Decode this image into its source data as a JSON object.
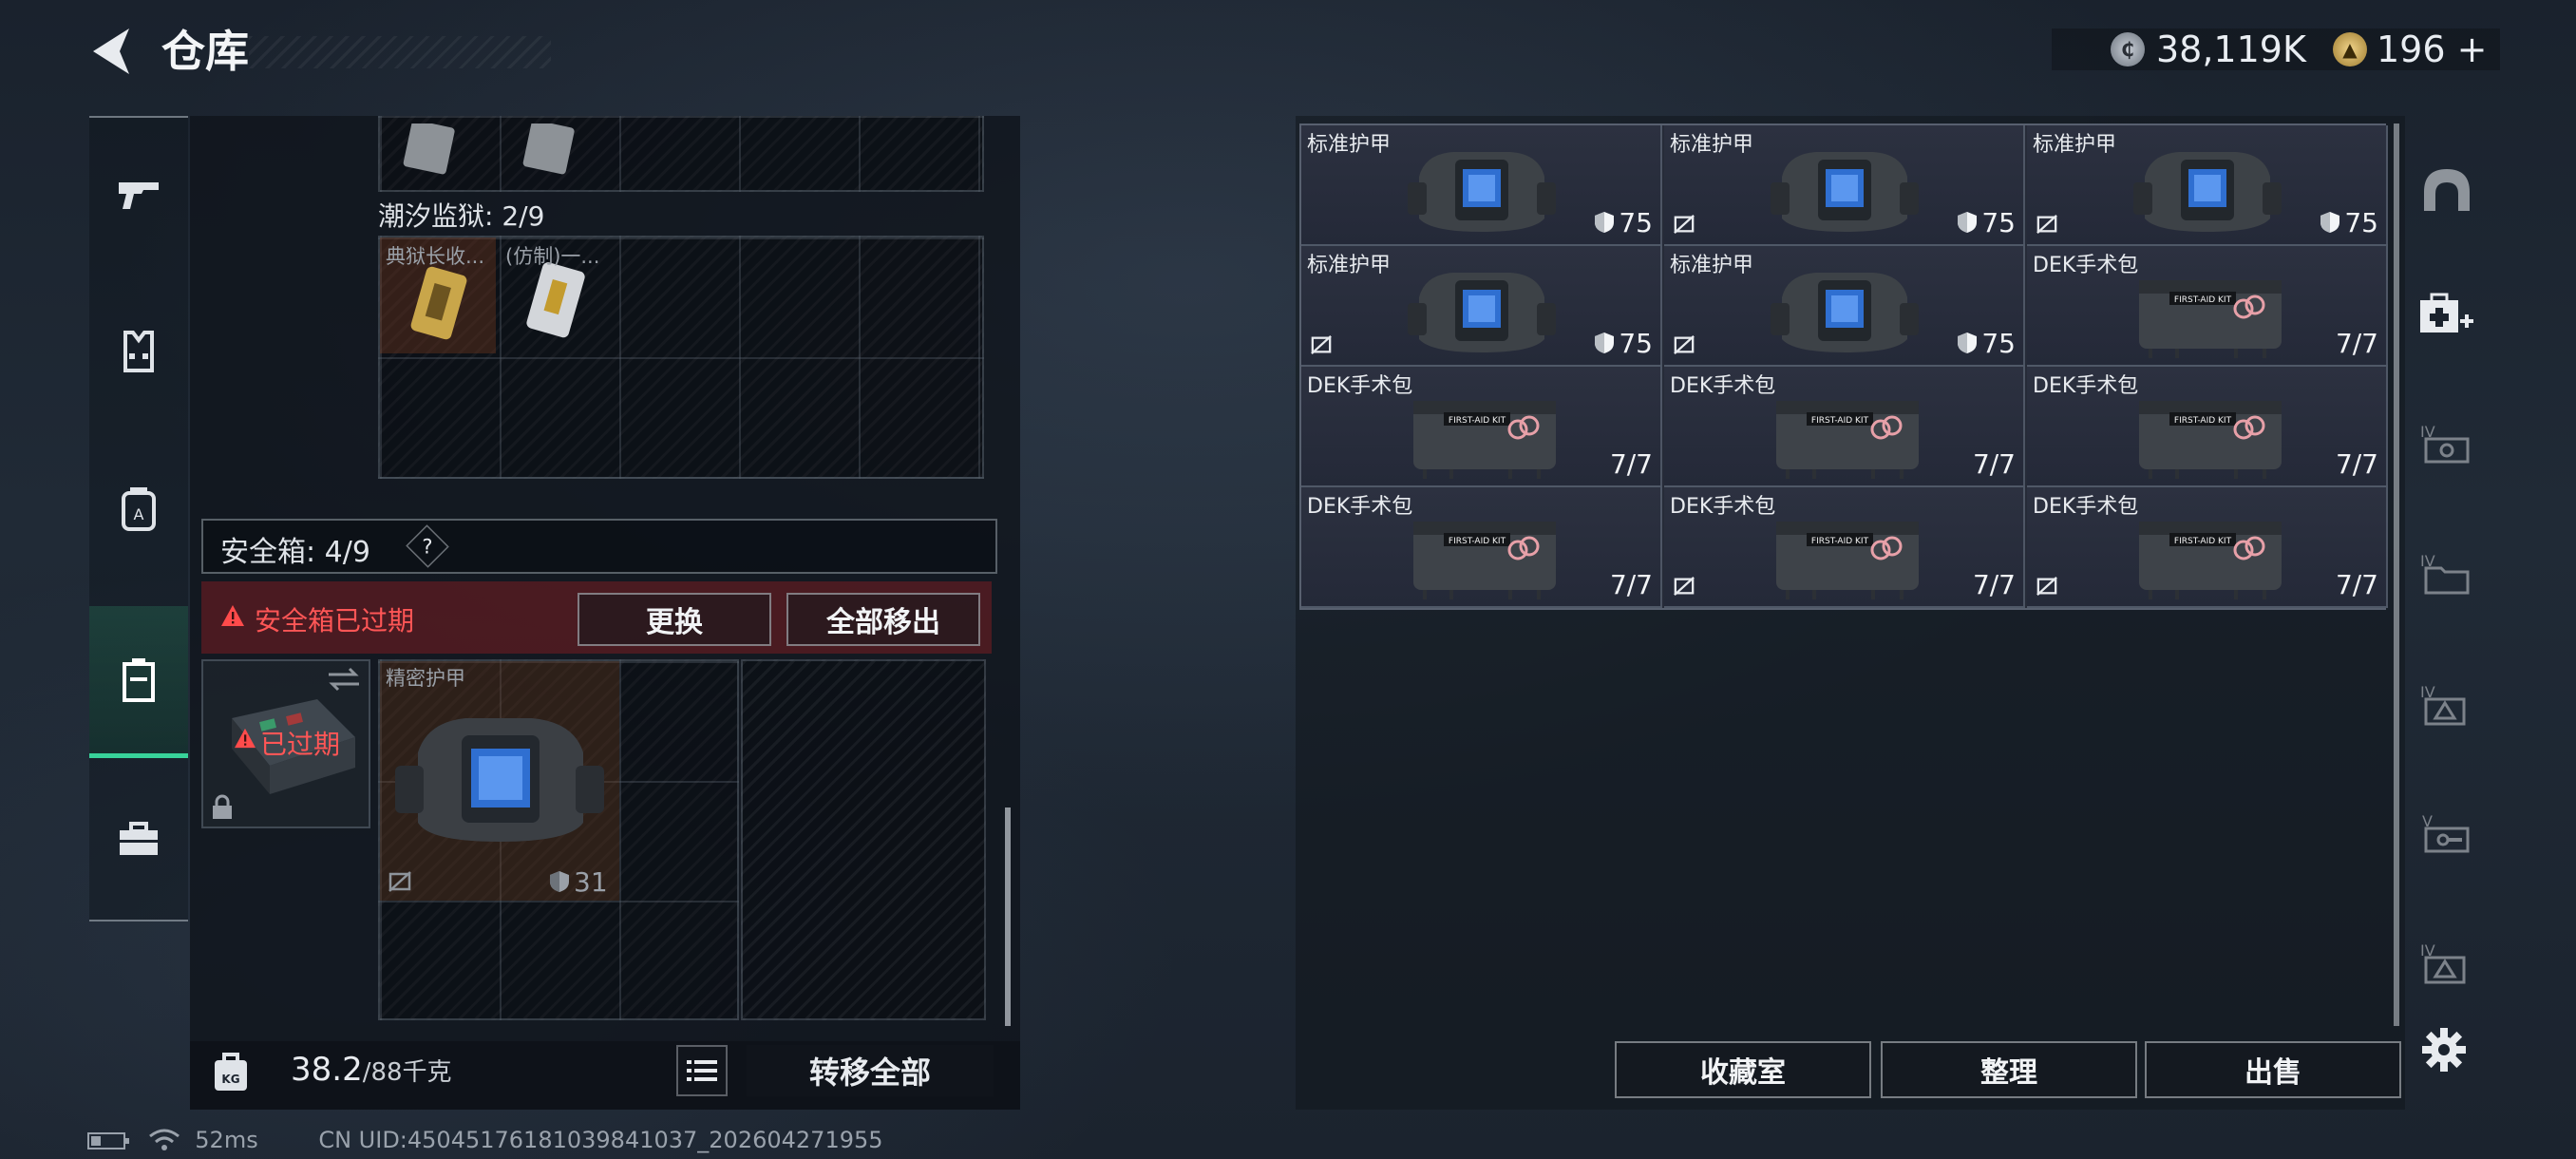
{
  "header": {
    "title": "仓库",
    "currency1": "38,119K",
    "currency2": "196",
    "currency2_plus": "+"
  },
  "leftnav": {
    "items": [
      "weapons",
      "armor",
      "backpack",
      "safe-box",
      "toolbox"
    ],
    "active": 3
  },
  "collections": {
    "prison_label": "潮汐监狱: 2/9",
    "prison_items": [
      "典狱长收...",
      "(仿制)一..."
    ]
  },
  "safe_box": {
    "title": "安全箱: 4/9",
    "help": "?",
    "warning": "安全箱已过期",
    "replace_label": "更换",
    "move_all_out_label": "全部移出",
    "expired_label": "已过期",
    "item_name": "精密护甲",
    "item_durability": "31"
  },
  "footer_left": {
    "weight": "38.2",
    "weight_max": "/88千克",
    "transfer_all_label": "转移全部"
  },
  "inventory": {
    "slots": [
      {
        "name": "标准护甲",
        "value": "75",
        "type": "armor",
        "nosell": false
      },
      {
        "name": "标准护甲",
        "value": "75",
        "type": "armor",
        "nosell": true
      },
      {
        "name": "标准护甲",
        "value": "75",
        "type": "armor",
        "nosell": true
      },
      {
        "name": "标准护甲",
        "value": "75",
        "type": "armor",
        "nosell": true
      },
      {
        "name": "标准护甲",
        "value": "75",
        "type": "armor",
        "nosell": true
      },
      {
        "name": "DEK手术包",
        "value": "7/7",
        "type": "kit",
        "nosell": false
      },
      {
        "name": "DEK手术包",
        "value": "7/7",
        "type": "kit",
        "nosell": false
      },
      {
        "name": "DEK手术包",
        "value": "7/7",
        "type": "kit",
        "nosell": false
      },
      {
        "name": "DEK手术包",
        "value": "7/7",
        "type": "kit",
        "nosell": false
      },
      {
        "name": "DEK手术包",
        "value": "7/7",
        "type": "kit",
        "nosell": false
      },
      {
        "name": "DEK手术包",
        "value": "7/7",
        "type": "kit",
        "nosell": true
      },
      {
        "name": "DEK手术包",
        "value": "7/7",
        "type": "kit",
        "nosell": true
      }
    ]
  },
  "bottom_buttons": {
    "collection": "收藏室",
    "sort": "整理",
    "sell": "出售"
  },
  "rightnav": [
    "helmet",
    "medkit",
    "IV-1",
    "IV-2",
    "IV-3",
    "V-1",
    "IV-4"
  ],
  "status": {
    "ping": "52ms",
    "uid": "CN UID:450451761810398410​37_202604271955"
  }
}
